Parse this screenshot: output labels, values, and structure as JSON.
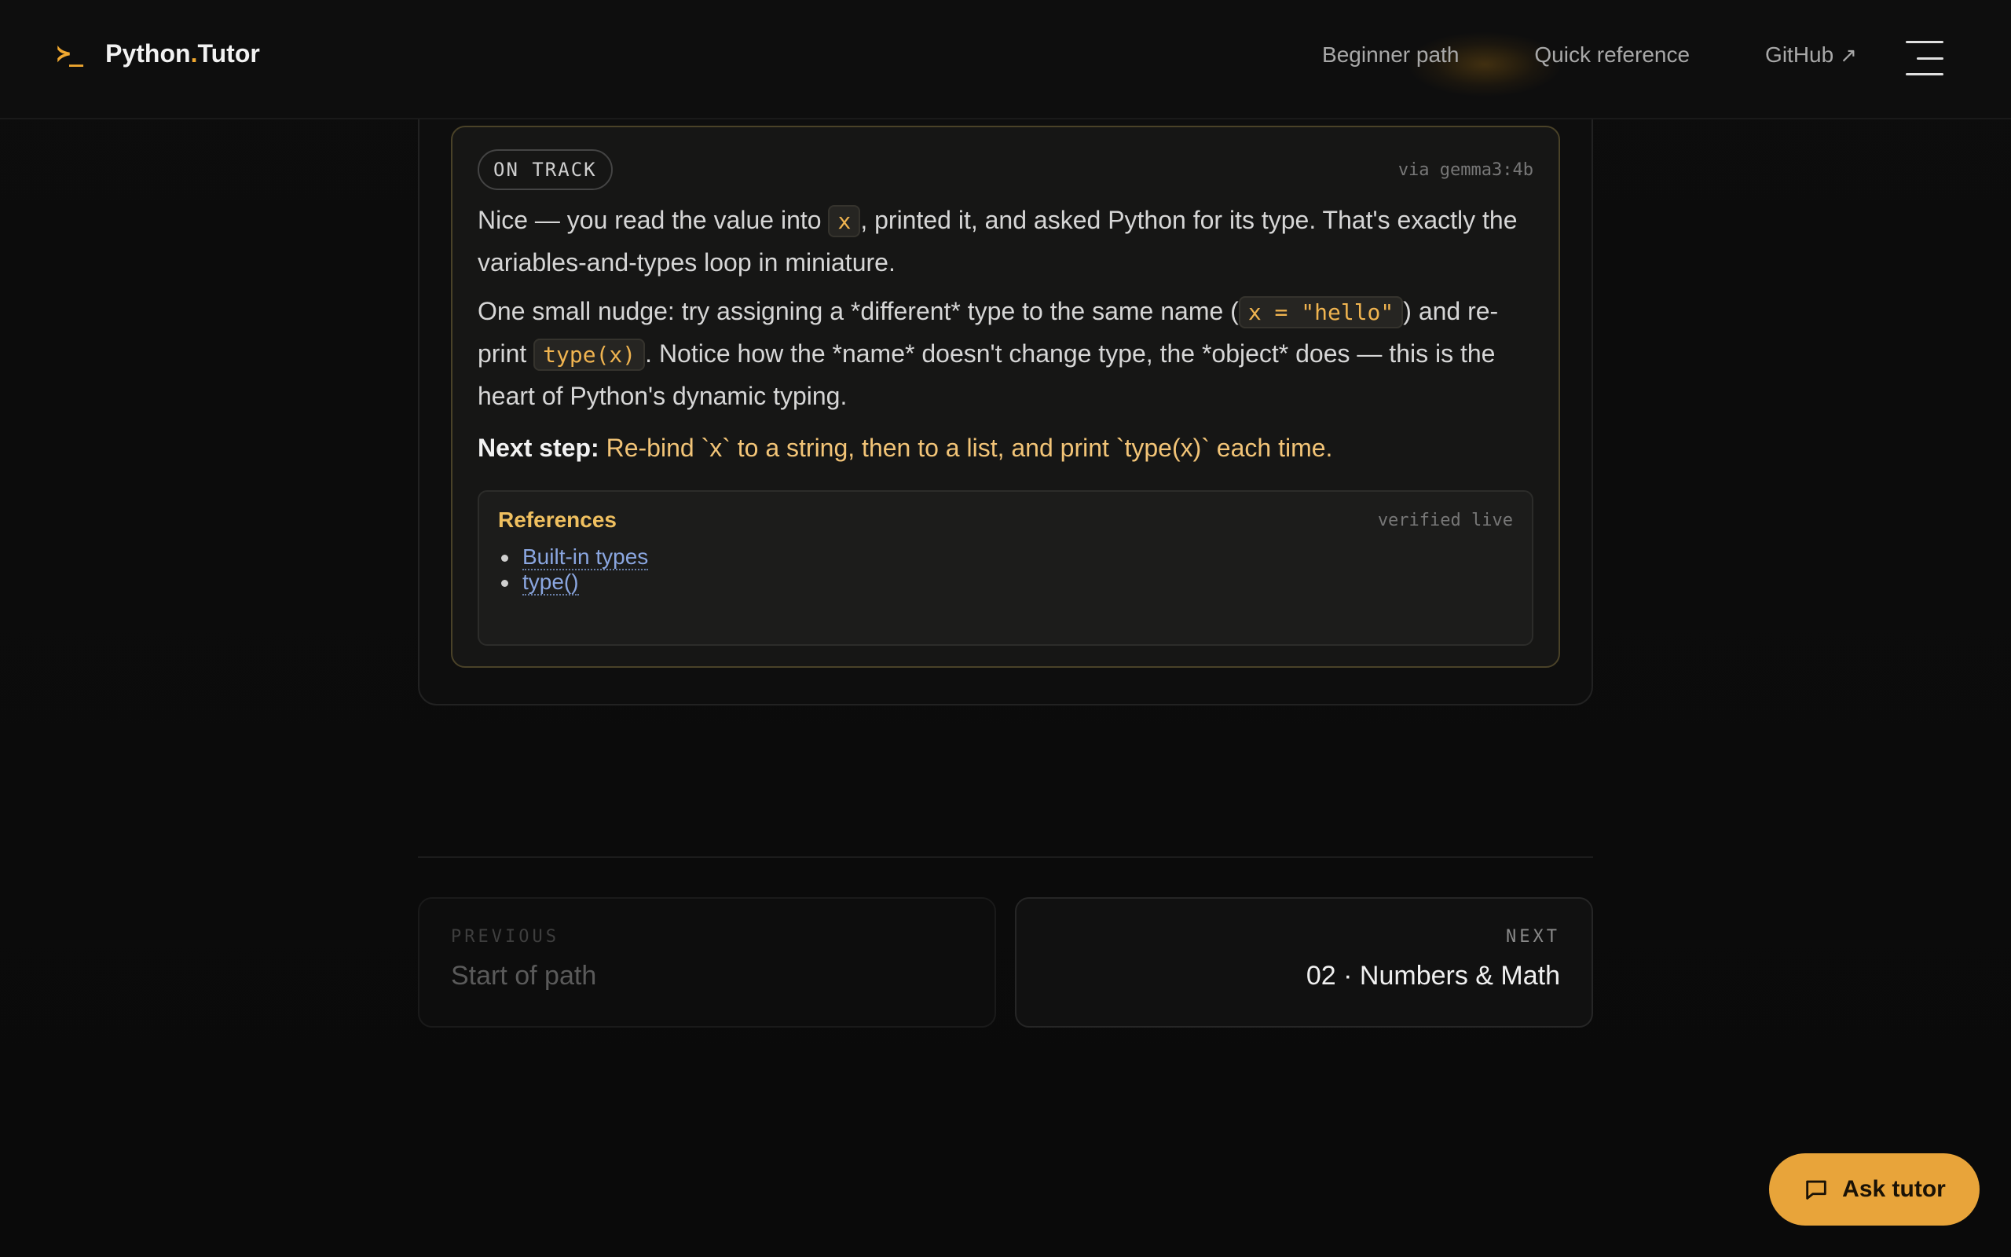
{
  "header": {
    "brand_mark": "≻_",
    "brand_name_a": "Python",
    "brand_name_dot": ".",
    "brand_name_b": "Tutor",
    "nav": [
      {
        "label": "Beginner path"
      },
      {
        "label": "Quick reference"
      },
      {
        "label": "GitHub",
        "ext_icon": "↗"
      }
    ]
  },
  "feedback": {
    "status": "ON TRACK",
    "model": "via gemma3:4b",
    "p1_a": "Nice — you read the value into ",
    "p1_code": "x",
    "p1_b": ", printed it, and asked Python for its type. That's exactly the variables-and-types loop in miniature.",
    "p2_a": "One small nudge: try assigning a *different* type to the same name (",
    "p2_code1": "x = \"hello\"",
    "p2_b": ") and re-print ",
    "p2_code2": "type(x)",
    "p2_c": ". Notice how the *name* doesn't change type, the *object* does — this is the heart of Python's dynamic typing.",
    "next_label": "Next step:",
    "next_text": "Re-bind `x` to a string, then to a list, and print `type(x)` each time."
  },
  "references": {
    "title": "References",
    "badge": "verified live",
    "items": [
      {
        "label": "Built-in types"
      },
      {
        "label": "type()"
      }
    ]
  },
  "pager": {
    "prev_kicker": "PREVIOUS",
    "prev_title": "Start of path",
    "next_kicker": "NEXT",
    "next_title": "02 · Numbers & Math"
  },
  "ask_tutor": {
    "label": "Ask tutor",
    "icon": "chat-bubble-icon"
  },
  "colors": {
    "accent": "#e8a43a",
    "link": "#8aa6e0",
    "code": "#f0b450"
  }
}
